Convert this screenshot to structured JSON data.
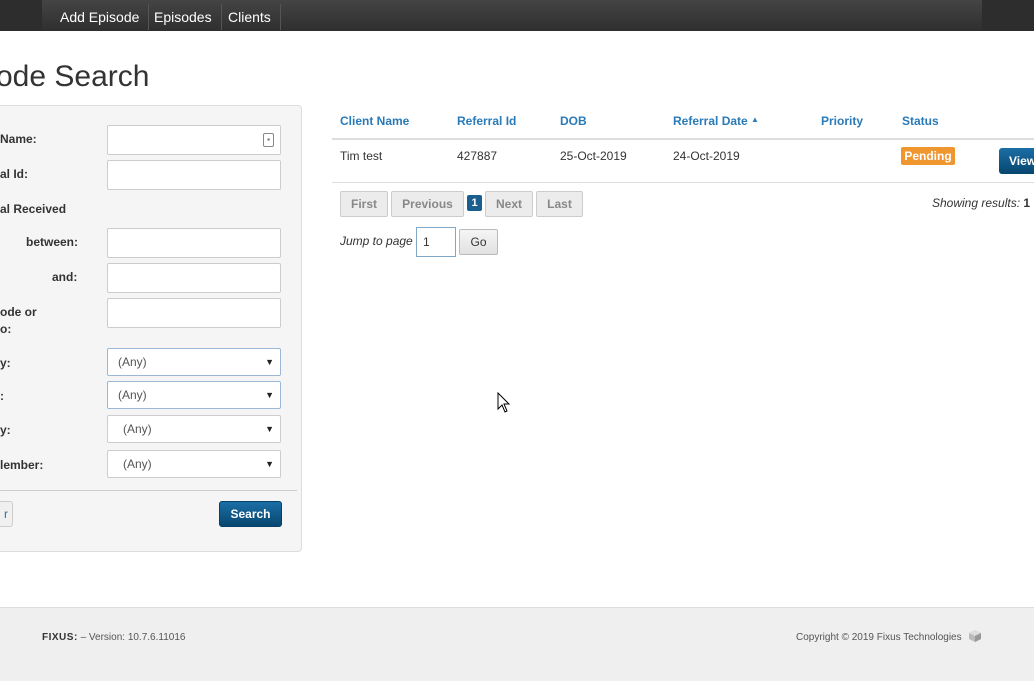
{
  "nav": {
    "items": [
      "Add Episode",
      "Episodes",
      "Clients"
    ]
  },
  "page": {
    "title": "ode Search"
  },
  "search_panel": {
    "labels": {
      "name": "Name:",
      "referral_id": "al Id:",
      "referral_received": "al Received",
      "between": "between:",
      "and": "and:",
      "postcode_line1": "ode or",
      "postcode_line2": "o:",
      "priority": "y:",
      "status": ":",
      "team": "y:",
      "member": "lember:"
    },
    "selects": {
      "priority": "(Any)",
      "status": "(Any)",
      "team": "(Any)",
      "member": "(Any)"
    },
    "clear_label": "r",
    "search_label": "Search"
  },
  "results": {
    "headers": [
      "Client Name",
      "Referral Id",
      "DOB",
      "Referral Date",
      "Priority",
      "Status"
    ],
    "sorted_column": "Referral Date",
    "rows": [
      {
        "client_name": "Tim test",
        "referral_id": "427887",
        "dob": "25-Oct-2019",
        "referral_date": "24-Oct-2019",
        "priority": "",
        "status": "Pending",
        "action": "View"
      }
    ]
  },
  "pagination": {
    "first": "First",
    "previous": "Previous",
    "current": "1",
    "next": "Next",
    "last": "Last",
    "showing_label": "Showing results:",
    "showing_value": "1",
    "jump_label": "Jump to page",
    "jump_value": "1",
    "go_label": "Go"
  },
  "footer": {
    "brand": "FIXUS:",
    "version": "– Version: 10.7.6.11016",
    "copyright": "Copyright © 2019 Fixus Technologies"
  },
  "colors": {
    "nav_bg": "#2d2d2d",
    "link": "#2a7ab8",
    "primary_button": "#0b5a8e",
    "pending_badge": "#f0962e"
  }
}
